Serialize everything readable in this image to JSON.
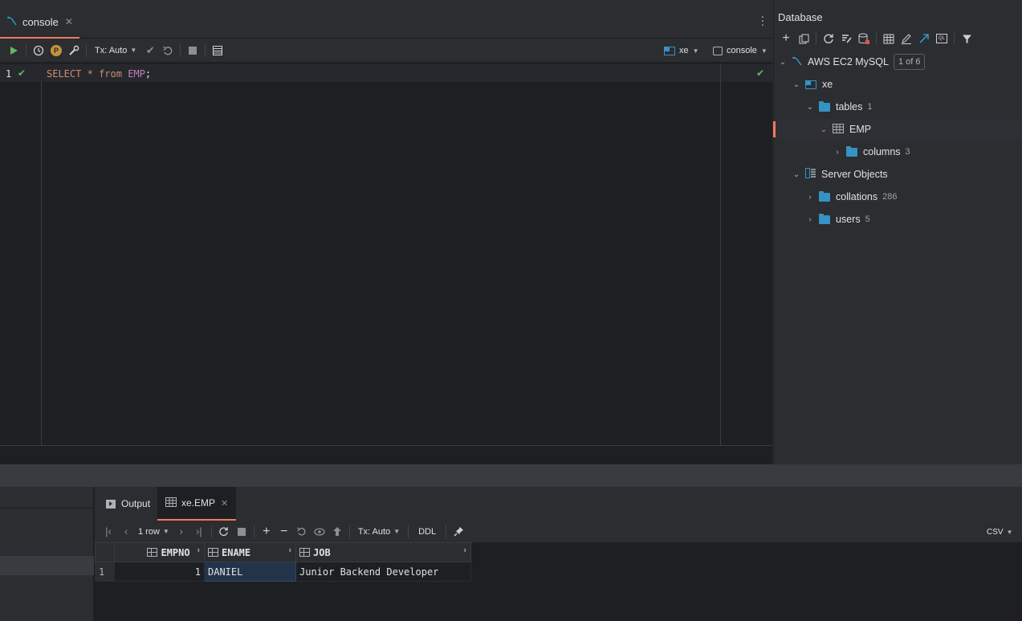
{
  "editor": {
    "tab_label": "console",
    "toolbar": {
      "tx_mode": "Tx: Auto",
      "schema": "xe",
      "session": "console"
    },
    "line_number": "1",
    "code": {
      "kw_select": "SELECT",
      "star": "*",
      "kw_from": "from",
      "table": "EMP",
      "semicolon": ";"
    }
  },
  "database": {
    "title": "Database",
    "datasource": {
      "name": "AWS EC2 MySQL",
      "badge": "1 of 6"
    },
    "schema": "xe",
    "tables": {
      "label": "tables",
      "count": "1"
    },
    "emp": "EMP",
    "columns": {
      "label": "columns",
      "count": "3"
    },
    "server_objects": "Server Objects",
    "collations": {
      "label": "collations",
      "count": "286"
    },
    "users": {
      "label": "users",
      "count": "5"
    }
  },
  "results": {
    "tabs": [
      "Output",
      "xe.EMP"
    ],
    "row_count": "1 row",
    "tx_mode": "Tx: Auto",
    "ddl_label": "DDL",
    "export_format": "CSV",
    "columns": [
      "EMPNO",
      "ENAME",
      "JOB"
    ],
    "rows": [
      {
        "num": "1",
        "empno": "1",
        "ename": "DANIEL",
        "job": "Junior Backend Developer"
      }
    ]
  },
  "colors": {
    "accent_tab": "#f0795c",
    "keyword": "#cf8e6d",
    "table_name": "#c77dbb",
    "run_green": "#5fb865",
    "folder_blue": "#3592c4"
  }
}
